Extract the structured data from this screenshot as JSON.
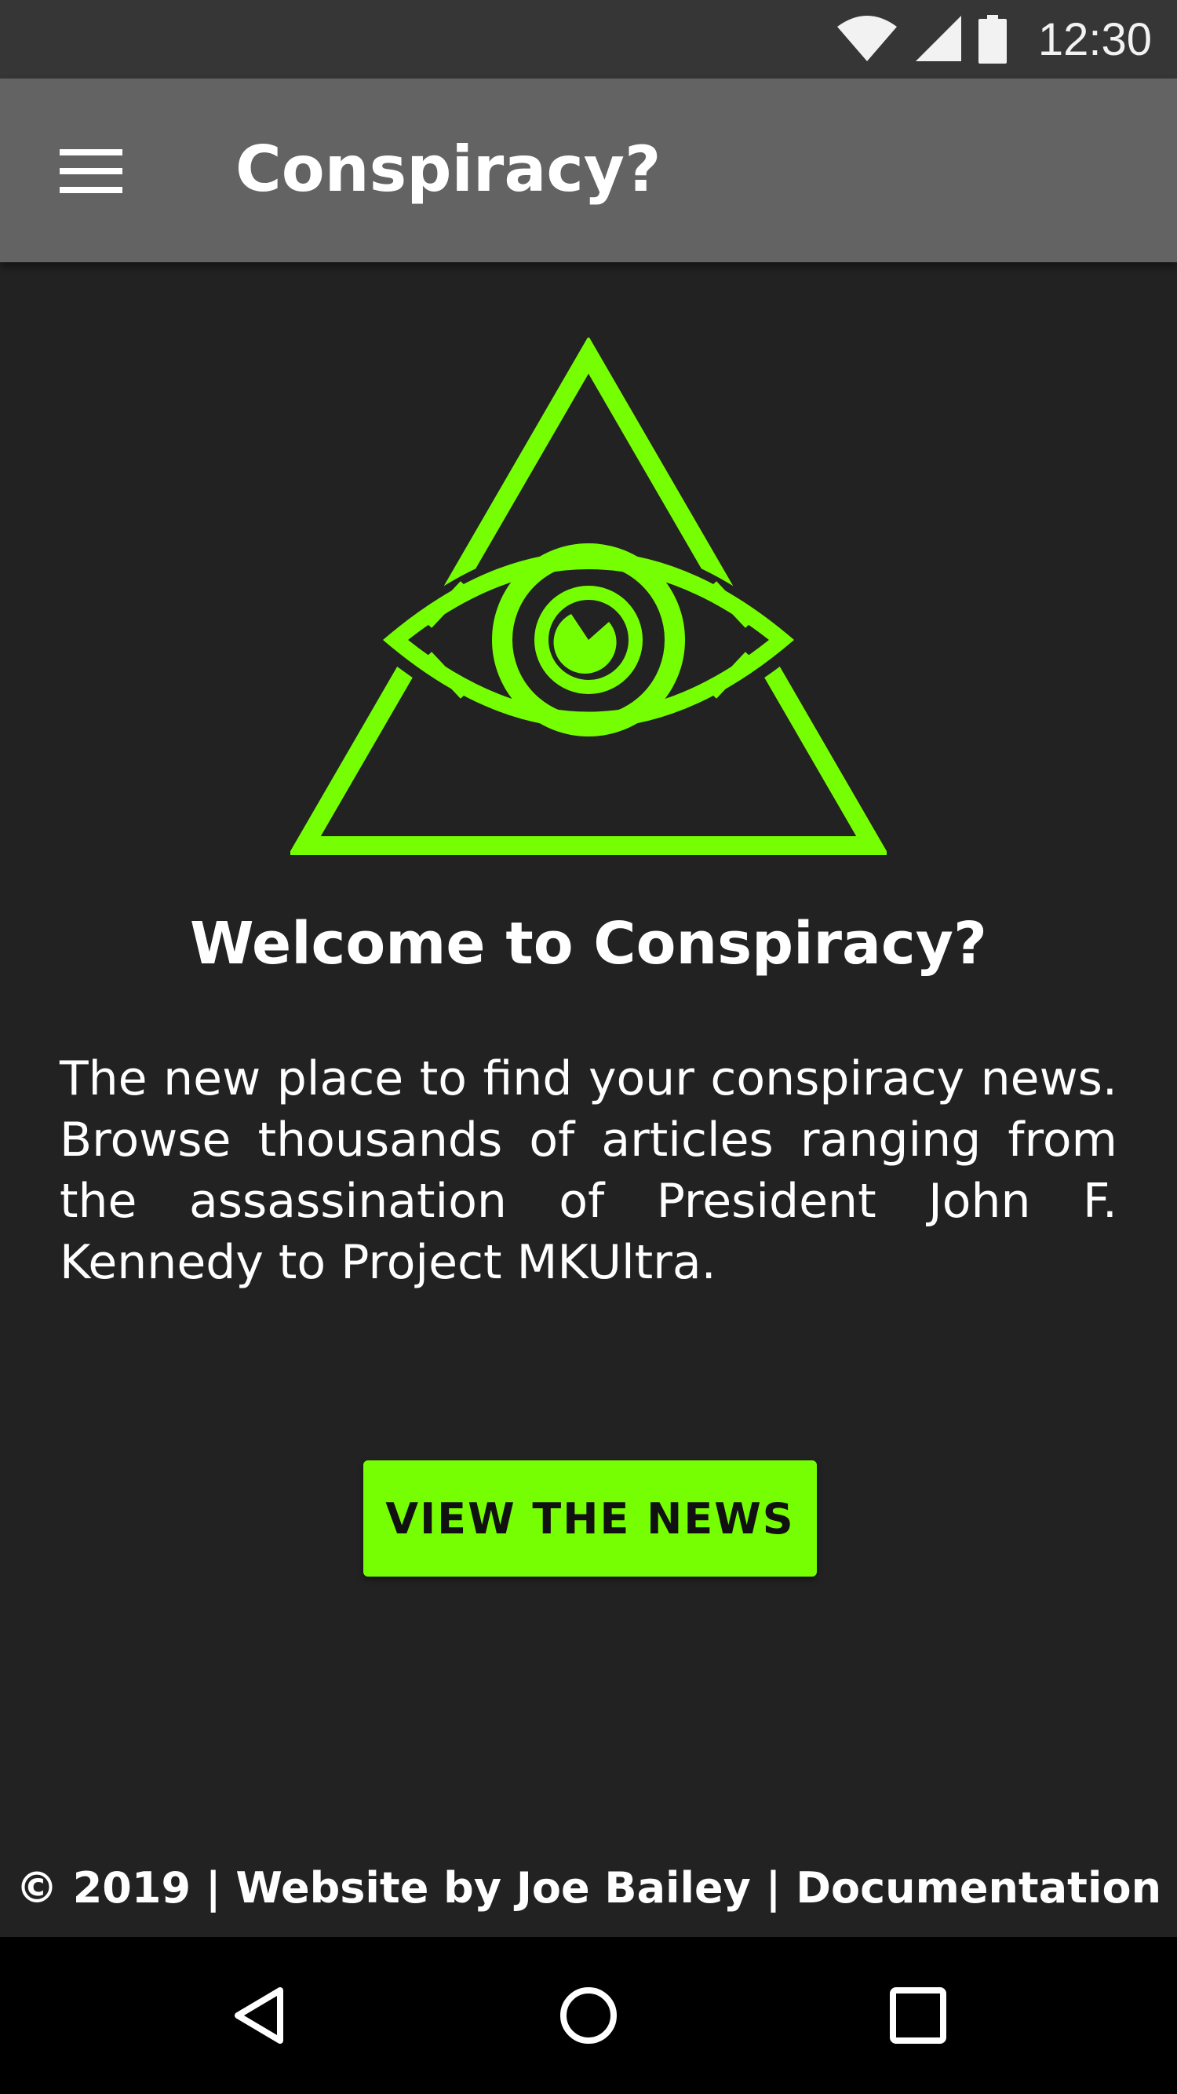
{
  "status_bar": {
    "time": "12:30",
    "icons": [
      "wifi-icon",
      "cell-signal-icon",
      "battery-icon"
    ]
  },
  "app_bar": {
    "menu_icon": "hamburger-menu-icon",
    "title": "Conspiracy?"
  },
  "hero": {
    "logo_icon": "all-seeing-eye-triangle-icon",
    "accent_color": "#76ff03",
    "heading": "Welcome to Conspiracy?",
    "body": "The new place to find your conspiracy news. Browse thousands of articles ranging from the assassination of President John F. Kennedy to Project MKUltra."
  },
  "cta": {
    "label": "VIEW THE NEWS"
  },
  "footer": {
    "copyright": "© 2019 | Website by ",
    "author_link": "Joe Bailey",
    "separator": " | ",
    "docs_link": "Documentation"
  },
  "nav_bar": {
    "buttons": [
      "back-icon",
      "home-icon",
      "recents-icon"
    ]
  }
}
